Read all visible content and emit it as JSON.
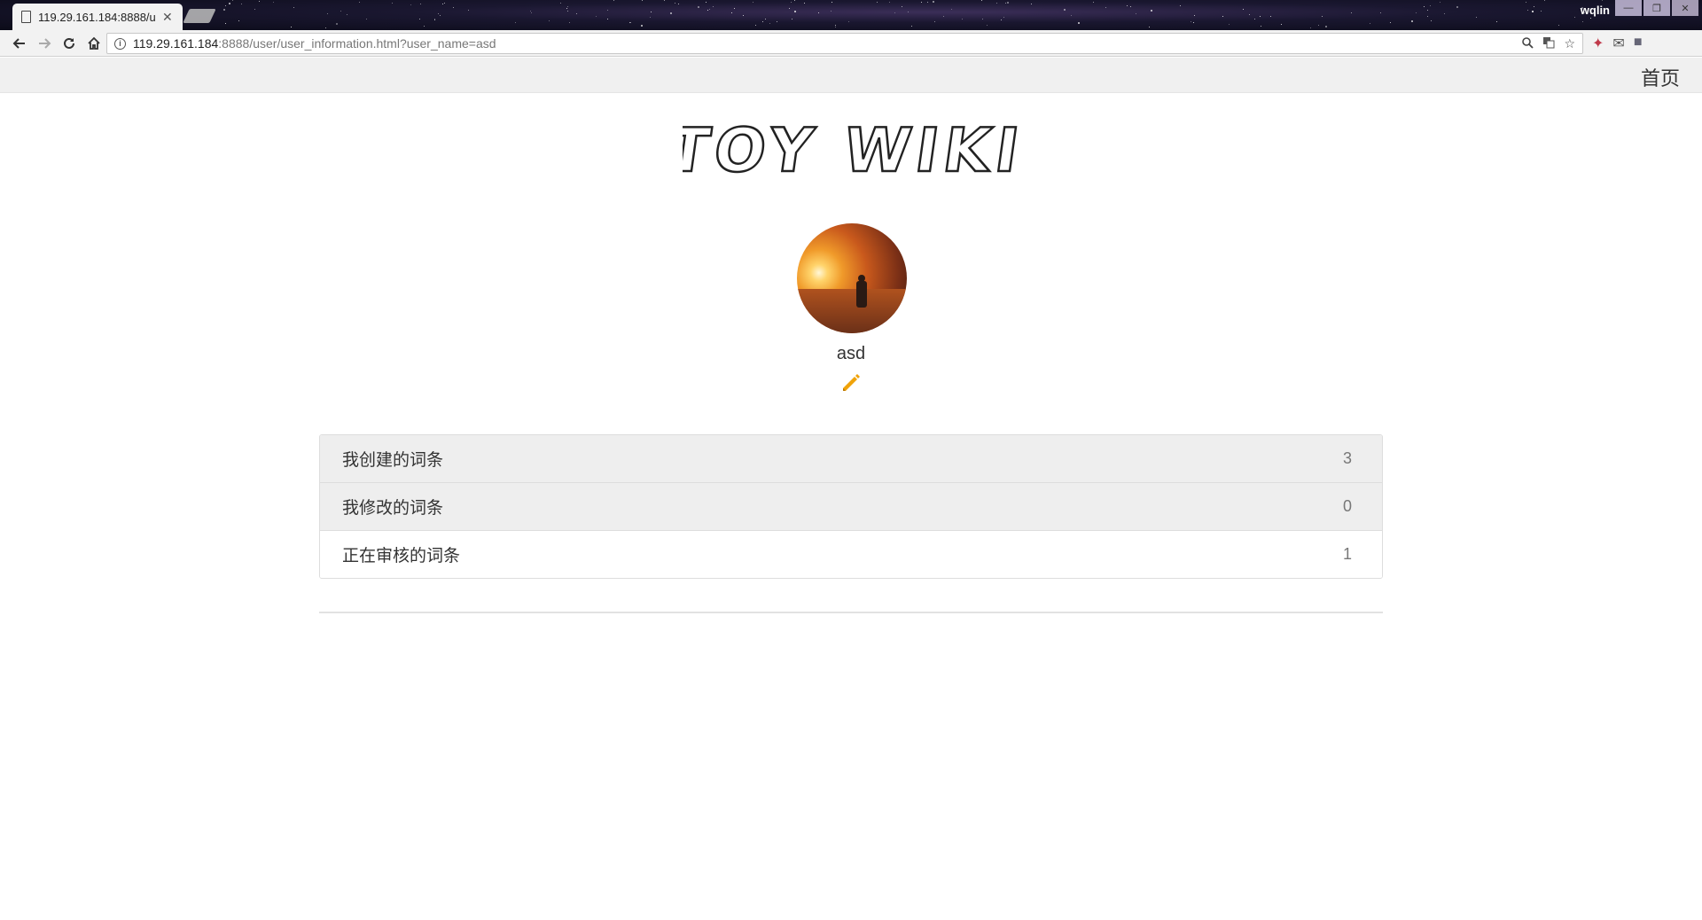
{
  "browser": {
    "tab_title": "119.29.161.184:8888/u",
    "url_host": "119.29.161.184",
    "url_rest": ":8888/user/user_information.html?user_name=asd",
    "profile_name": "wqlin"
  },
  "nav": {
    "home_label": "首页"
  },
  "logo": {
    "text": "TOY WIKI"
  },
  "user": {
    "name": "asd"
  },
  "stats": [
    {
      "label": "我创建的词条",
      "count": "3"
    },
    {
      "label": "我修改的词条",
      "count": "0"
    },
    {
      "label": "正在审核的词条",
      "count": "1"
    }
  ],
  "colors": {
    "edit_icon": "#f0a30a",
    "nav_bg": "#f0f0f0",
    "row_shaded": "#eeeeee"
  },
  "icons": [
    "page-icon",
    "back-arrow-icon",
    "forward-arrow-icon",
    "reload-icon",
    "home-icon",
    "info-icon",
    "zoom-icon",
    "translate-icon",
    "star-icon",
    "pencil-icon"
  ]
}
